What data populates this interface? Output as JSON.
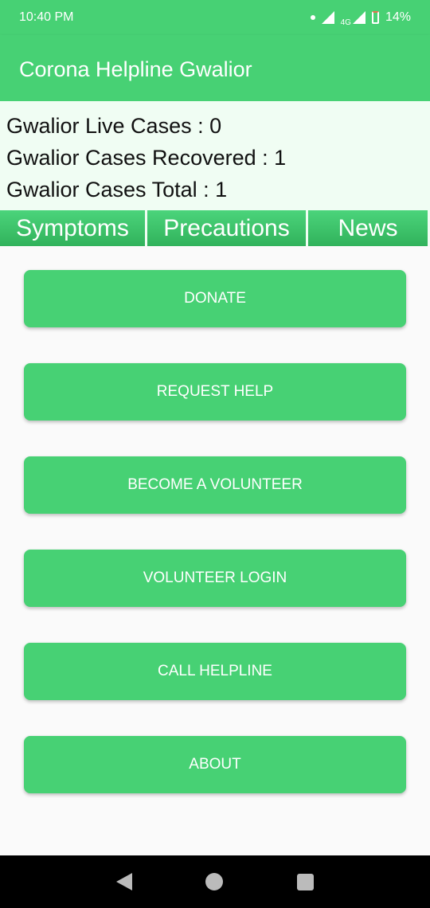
{
  "status": {
    "time": "10:40 PM",
    "network": "4G",
    "battery": "14%"
  },
  "appbar": {
    "title": "Corona Helpline Gwalior"
  },
  "stats": [
    "Gwalior Live Cases : 0",
    "Gwalior Cases Recovered : 1",
    "Gwalior Cases Total : 1"
  ],
  "tabs": [
    "Symptoms",
    "Precautions",
    "News"
  ],
  "buttons": [
    "DONATE",
    "REQUEST HELP",
    "BECOME A VOLUNTEER",
    "VOLUNTEER LOGIN",
    "CALL HELPLINE",
    "ABOUT"
  ]
}
